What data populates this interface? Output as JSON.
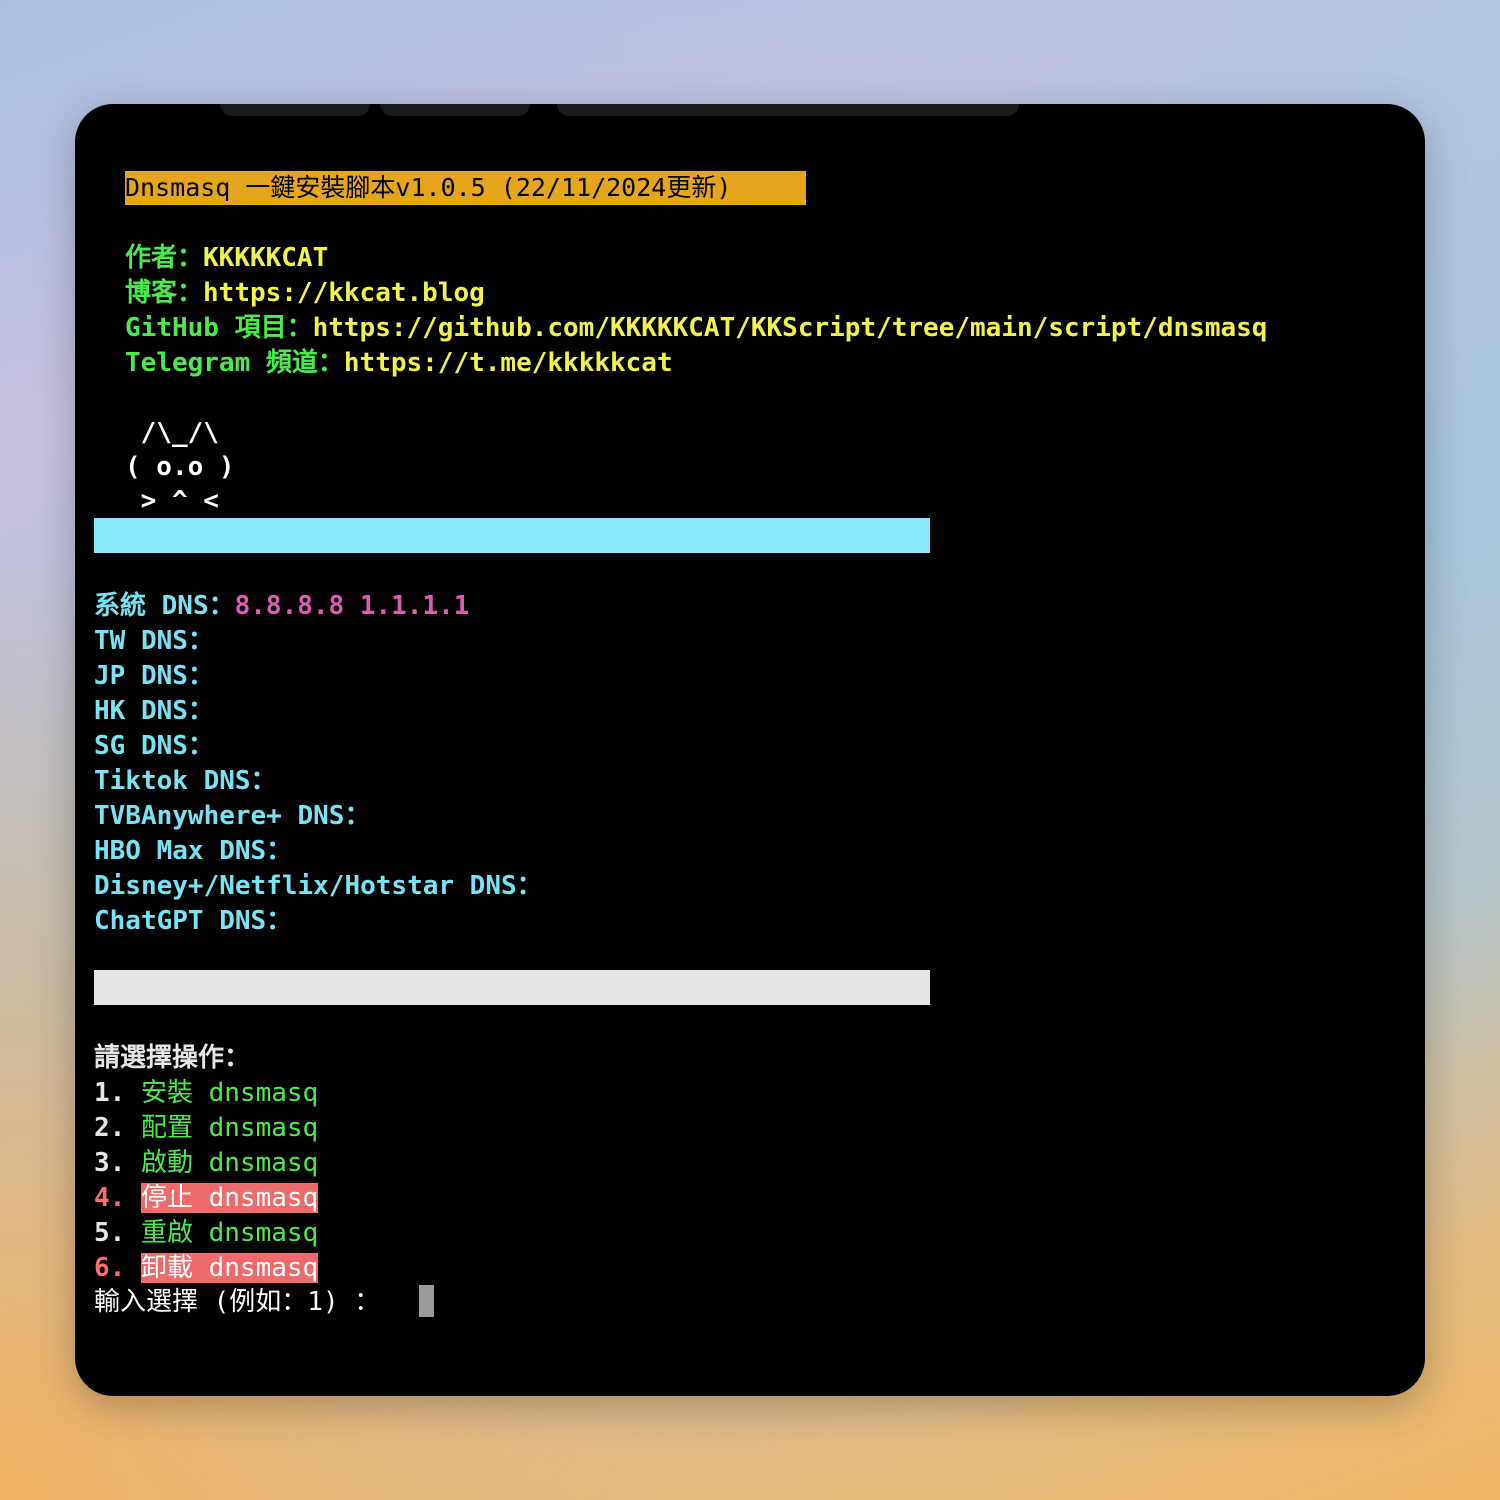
{
  "title": "Dnsmasq 一鍵安裝腳本v1.0.5 (22/11/2024更新)",
  "info": [
    {
      "label": "作者：",
      "value": "KKKKKCAT"
    },
    {
      "label": "博客：",
      "value": "https://kkcat.blog"
    },
    {
      "label": "GitHub 項目：",
      "value": "https://github.com/KKKKKCAT/KKScript/tree/main/script/dnsmasq"
    },
    {
      "label": "Telegram 頻道：",
      "value": "https://t.me/kkkkkcat"
    }
  ],
  "ascii_art": [
    " /\\_/\\",
    "( o.o )",
    " > ^ <"
  ],
  "dns": {
    "system_label": "系統 DNS：",
    "system_value": "8.8.8.8 1.1.1.1",
    "entries": [
      "TW DNS：",
      "JP DNS：",
      "HK DNS：",
      "SG DNS：",
      "Tiktok DNS：",
      "TVBAnywhere+ DNS：",
      "HBO Max DNS：",
      "Disney+/Netflix/Hotstar DNS：",
      "ChatGPT DNS："
    ]
  },
  "menu": {
    "prompt_title": "請選擇操作：",
    "options": [
      {
        "num": "1.",
        "label": "安裝 dnsmasq"
      },
      {
        "num": "2.",
        "label": "配置 dnsmasq"
      },
      {
        "num": "3.",
        "label": "啟動 dnsmasq"
      },
      {
        "num": "4.",
        "label": "停止 dnsmasq"
      },
      {
        "num": "5.",
        "label": "重啟 dnsmasq"
      },
      {
        "num": "6.",
        "label": "卸載 dnsmasq"
      }
    ],
    "input_prompt": "輸入選擇 (例如：1) ："
  },
  "colors": {
    "title_bg": "#e5a51c",
    "green": "#4dea4d",
    "yellow": "#f2f24d",
    "cyan": "#79e3f5",
    "magenta": "#e05bb5",
    "red": "#f76f6f",
    "cyan_bar": "#8ae8fb",
    "gray_bar": "#e6e6e6"
  }
}
